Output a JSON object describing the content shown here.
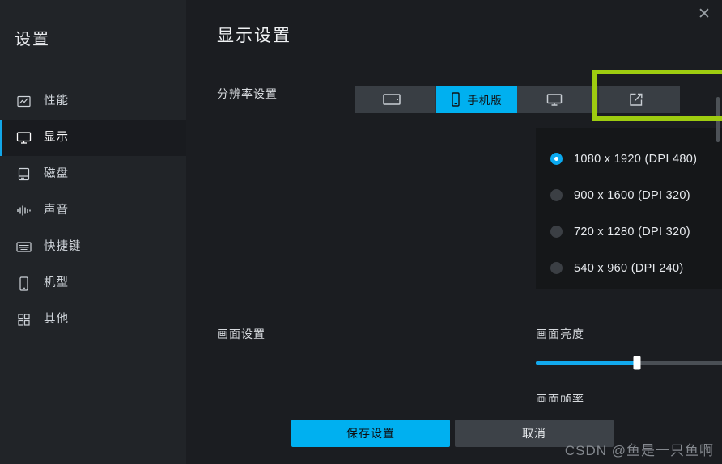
{
  "window": {
    "close_label": "✕",
    "accent_color": "#00b0f0",
    "annotation_color": "#9ecc10",
    "sidebar_bg": "#212428",
    "main_bg": "#1b1d21",
    "panel_bg": "#151719"
  },
  "sidebar": {
    "title": "设置",
    "items": [
      {
        "label": "性能",
        "icon": "chart-icon",
        "active": false
      },
      {
        "label": "显示",
        "icon": "monitor-icon",
        "active": true
      },
      {
        "label": "磁盘",
        "icon": "disk-icon",
        "active": false
      },
      {
        "label": "声音",
        "icon": "waveform-icon",
        "active": false
      },
      {
        "label": "快捷键",
        "icon": "keyboard-icon",
        "active": false
      },
      {
        "label": "机型",
        "icon": "phone-icon",
        "active": false
      },
      {
        "label": "其他",
        "icon": "grid-icon",
        "active": false
      }
    ]
  },
  "header": {
    "title": "显示设置"
  },
  "resolution": {
    "label": "分辨率设置",
    "tabs": [
      {
        "label": "",
        "icon": "tablet-landscape-icon",
        "active": false
      },
      {
        "label": "手机版",
        "icon": "phone-portrait-icon",
        "active": true
      },
      {
        "label": "",
        "icon": "monitor-icon",
        "active": false
      },
      {
        "label": "",
        "icon": "edit-square-icon",
        "active": false
      }
    ],
    "options": [
      {
        "label": "1080 x 1920 (DPI 480)",
        "selected": true
      },
      {
        "label": "900 x 1600 (DPI 320)",
        "selected": false
      },
      {
        "label": "720 x 1280 (DPI 320)",
        "selected": false
      },
      {
        "label": "540 x 960 (DPI 240)",
        "selected": false
      }
    ]
  },
  "picture": {
    "label": "画面设置",
    "brightness_label": "画面亮度",
    "brightness_value": "50",
    "brightness_percent": 50,
    "clipped_label": "画面帧率"
  },
  "footer": {
    "save_label": "保存设置",
    "cancel_label": "取消"
  },
  "watermark": {
    "text": "CSDN @鱼是一只鱼啊"
  }
}
